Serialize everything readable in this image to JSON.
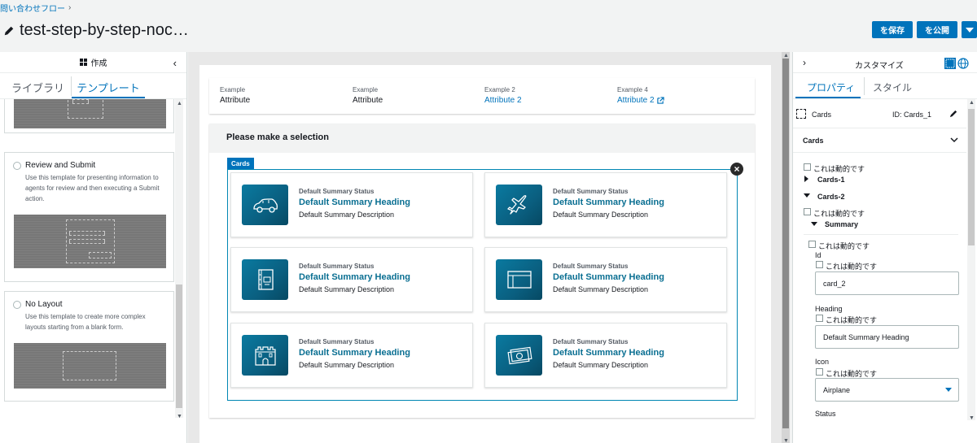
{
  "header": {
    "breadcrumb": "問い合わせフロー",
    "title": "test-step-by-step-noc…",
    "save_label": "を保存",
    "publish_label": "を公開"
  },
  "left_panel": {
    "header_label": "作成",
    "tabs": [
      "ライブラリ",
      "テンプレート"
    ],
    "active_tab": "テンプレート",
    "templates": [
      {
        "title": "Review and Submit",
        "description": "Use this template for presenting information to agents for review and then executing a Submit action."
      },
      {
        "title": "No Layout",
        "description": "Use this template to create more complex layouts starting from a blank form."
      }
    ]
  },
  "canvas": {
    "attributes": [
      {
        "label": "Example",
        "value": "Attribute",
        "link": false
      },
      {
        "label": "Example",
        "value": "Attribute",
        "link": false
      },
      {
        "label": "Example 2",
        "value": "Attribute 2",
        "link": true
      },
      {
        "label": "Example 4",
        "value": "Attribute 2",
        "link": true
      }
    ],
    "selection_title": "Please make a selection",
    "cards_tag": "Cards",
    "cards": [
      {
        "status": "Default Summary Status",
        "heading": "Default Summary Heading",
        "description": "Default Summary Description",
        "icon": "car-icon"
      },
      {
        "status": "Default Summary Status",
        "heading": "Default Summary Heading",
        "description": "Default Summary Description",
        "icon": "airplane-icon"
      },
      {
        "status": "Default Summary Status",
        "heading": "Default Summary Heading",
        "description": "Default Summary Description",
        "icon": "notebook-icon"
      },
      {
        "status": "Default Summary Status",
        "heading": "Default Summary Heading",
        "description": "Default Summary Description",
        "icon": "browser-window-icon"
      },
      {
        "status": "Default Summary Status",
        "heading": "Default Summary Heading",
        "description": "Default Summary Description",
        "icon": "castle-icon"
      },
      {
        "status": "Default Summary Status",
        "heading": "Default Summary Heading",
        "description": "Default Summary Description",
        "icon": "money-icon"
      }
    ]
  },
  "right_panel": {
    "header_label": "カスタマイズ",
    "tabs": [
      "プロパティ",
      "スタイル"
    ],
    "active_tab": "プロパティ",
    "component_name": "Cards",
    "component_id": "ID: Cards_1",
    "section_title": "Cards",
    "dynamic_label": "これは動的です",
    "tree": {
      "cards1": "Cards-1",
      "cards2": "Cards-2",
      "summary": "Summary"
    },
    "fields": {
      "id_label": "Id",
      "id_value": "card_2",
      "heading_label": "Heading",
      "heading_value": "Default Summary Heading",
      "icon_label": "Icon",
      "icon_value": "Airplane",
      "status_label": "Status"
    }
  },
  "colors": {
    "accent": "#0073bb",
    "card_heading": "#0a6f92",
    "icon_tile": "#0a6f92"
  }
}
